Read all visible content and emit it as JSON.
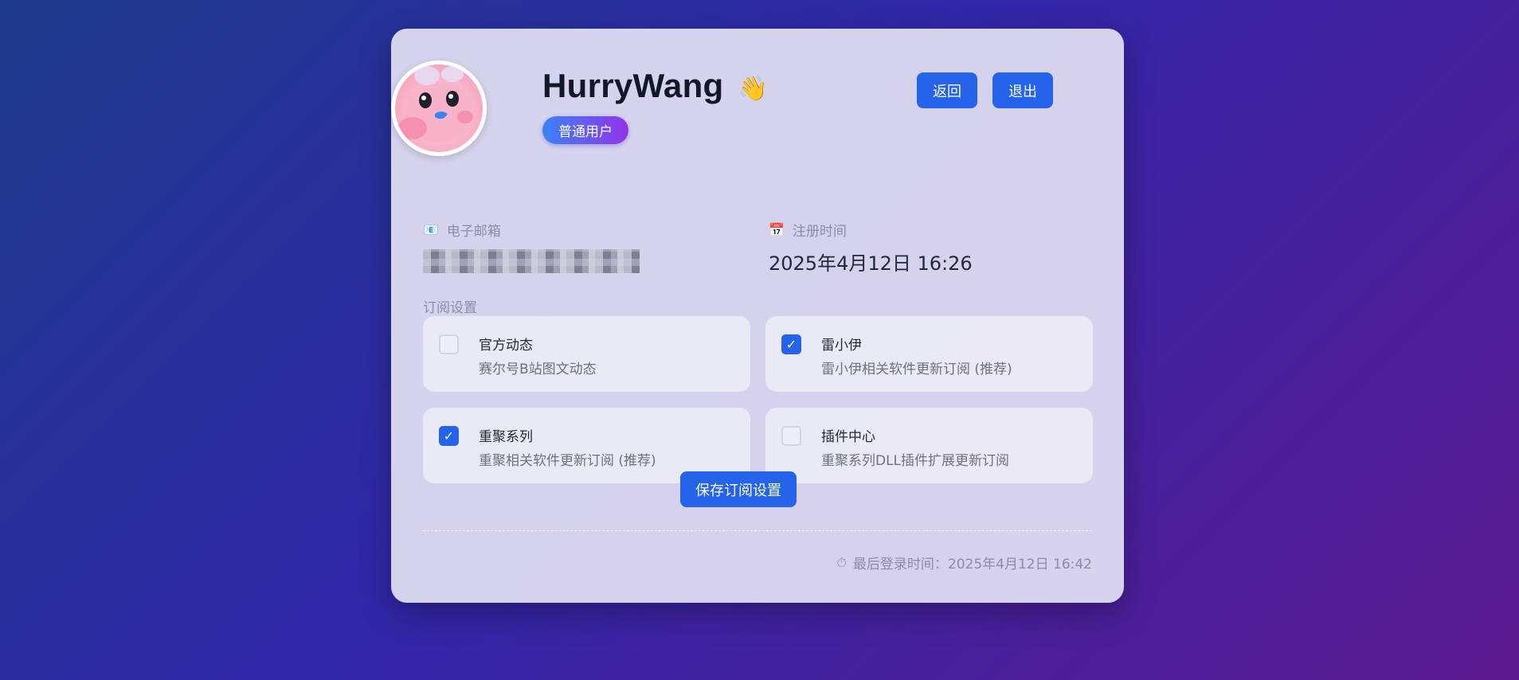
{
  "profile": {
    "username": "HurryWang",
    "wave_emoji": "👋",
    "role": "普通用户"
  },
  "actions": {
    "back_label": "返回",
    "logout_label": "退出"
  },
  "info": {
    "email_icon": "📧",
    "email_label": "电子邮箱",
    "calendar_icon": "📅",
    "register_label": "注册时间",
    "register_value": "2025年4月12日 16:26"
  },
  "subscriptions": {
    "title": "订阅设置",
    "items": [
      {
        "title": "官方动态",
        "desc": "赛尔号B站图文动态",
        "checked": false
      },
      {
        "title": "雷小伊",
        "desc": "雷小伊相关软件更新订阅 (推荐)",
        "checked": true
      },
      {
        "title": "重聚系列",
        "desc": "重聚相关软件更新订阅 (推荐)",
        "checked": true
      },
      {
        "title": "插件中心",
        "desc": "重聚系列DLL插件扩展更新订阅",
        "checked": false
      }
    ],
    "check_mark": "✓",
    "save_label": "保存订阅设置"
  },
  "footer": {
    "timer_icon": "⏱",
    "last_login": "最后登录时间：2025年4月12日 16:42"
  },
  "colors": {
    "accent": "#2563eb",
    "badge_start": "#3b82f6",
    "badge_end": "#9333ea"
  }
}
